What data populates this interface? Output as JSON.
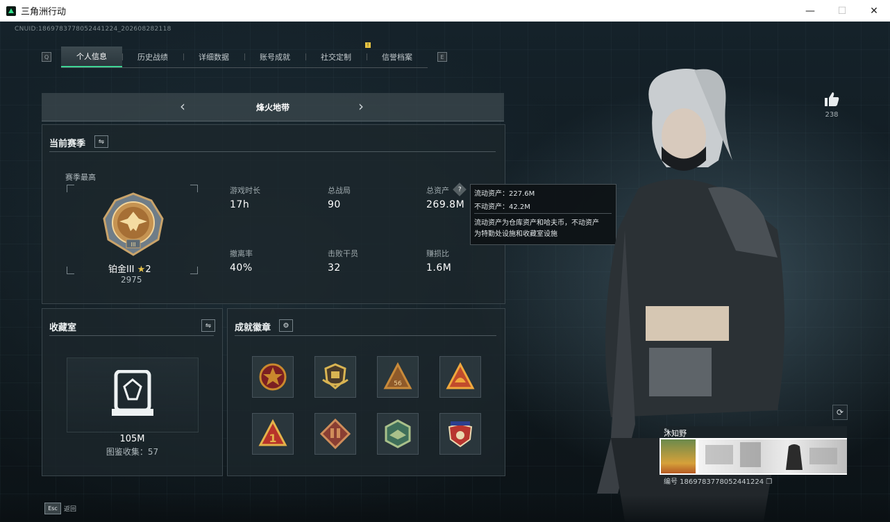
{
  "window": {
    "title": "三角洲行动",
    "minimize": "—",
    "maximize": "☐",
    "close": "✕"
  },
  "uid": "CNUID:1869783778052441224_202608282118",
  "tabs": {
    "left_key": "Q",
    "right_key": "E",
    "items": [
      {
        "label": "个人信息",
        "active": true
      },
      {
        "label": "历史战绩",
        "active": false
      },
      {
        "label": "详细数据",
        "active": false
      },
      {
        "label": "账号成就",
        "active": false
      },
      {
        "label": "社交定制",
        "active": false,
        "badge": "!"
      },
      {
        "label": "信誉档案",
        "active": false
      }
    ]
  },
  "mode": {
    "label": "烽火地带",
    "prev": "‹",
    "next": "›"
  },
  "season": {
    "title": "当前赛季",
    "best_label": "赛季最高",
    "rank_name": "铂金III",
    "rank_stars": "2",
    "rank_points": "2975",
    "stats": [
      {
        "label": "游戏时长",
        "value": "17h"
      },
      {
        "label": "总战局",
        "value": "90"
      },
      {
        "label": "总资产",
        "value": "269.8M"
      },
      {
        "label": "撤离率",
        "value": "40%"
      },
      {
        "label": "击败干员",
        "value": "32"
      },
      {
        "label": "赚损比",
        "value": "1.6M"
      }
    ],
    "help_symbol": "?"
  },
  "tooltip": {
    "liquid": "流动资产：227.6M",
    "fixed": "不动资产：42.2M",
    "desc1": "流动资产为仓库资产和哈夫币，不动资产",
    "desc2": "为特勤处设施和收藏室设施"
  },
  "collection": {
    "title": "收藏室",
    "value": "105M",
    "catalog": "图鉴收集：57"
  },
  "badges": {
    "title": "成就徽章",
    "items": [
      {
        "icon": "star-medal-badge-icon",
        "colors": [
          "#c9892d",
          "#7b1f22"
        ]
      },
      {
        "icon": "shield-wings-badge-icon",
        "colors": [
          "#d9b452",
          "#4a3b2a"
        ]
      },
      {
        "icon": "triangle-56-badge-icon",
        "colors": [
          "#c88a3a",
          "#8f5a2a"
        ]
      },
      {
        "icon": "triangle-helmet-badge-icon",
        "colors": [
          "#c14b2c",
          "#f0a83c"
        ]
      },
      {
        "icon": "triangle-one-badge-icon",
        "colors": [
          "#b8332a",
          "#e4b24a"
        ]
      },
      {
        "icon": "diamond-ammo-badge-icon",
        "colors": [
          "#8a3e33",
          "#cf8d5a"
        ]
      },
      {
        "icon": "hex-eagle-badge-icon",
        "colors": [
          "#3f6f5a",
          "#a9c08a"
        ]
      },
      {
        "icon": "star-shield-badge-icon",
        "colors": [
          "#b8352f",
          "#2c3f8f"
        ]
      }
    ]
  },
  "profile": {
    "likes": "238",
    "name": "沐知野",
    "player_no": "编号 1869783778052441224"
  },
  "footer": {
    "esc_key": "Esc",
    "esc_label": "返回"
  }
}
